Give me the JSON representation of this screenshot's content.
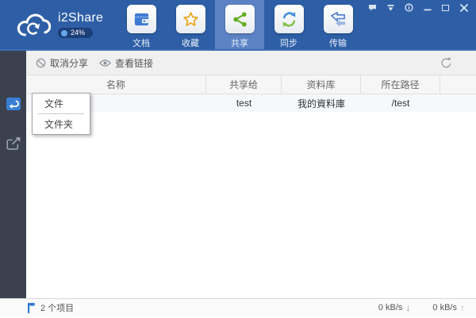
{
  "app": {
    "title": "i2Share",
    "progress_label": "24%"
  },
  "header": {
    "tabs": [
      {
        "label": "文档",
        "icon": "documents-icon"
      },
      {
        "label": "收藏",
        "icon": "favorites-star-icon"
      },
      {
        "label": "共享",
        "icon": "share-icon",
        "active": true
      },
      {
        "label": "同步",
        "icon": "sync-icon"
      },
      {
        "label": "传输",
        "icon": "transfer-icon"
      }
    ],
    "window_controls": [
      "feedback-icon",
      "menu-icon",
      "info-icon",
      "minimize-icon",
      "maximize-icon",
      "close-icon"
    ]
  },
  "toolbar": {
    "cancel_share": "取消分享",
    "view_links": "查看链接"
  },
  "table": {
    "columns": [
      "名称",
      "共享给",
      "资料库",
      "所在路径"
    ],
    "rows": [
      {
        "name": "",
        "shared_to": "test",
        "library": "我的資料庫",
        "path": "/test"
      }
    ]
  },
  "context_menu": {
    "items": [
      {
        "label": "文件"
      },
      {
        "label": "文件夹"
      }
    ]
  },
  "status_bar": {
    "item_count": "2 个项目",
    "download_speed": "0 kB/s",
    "download_arrow": "↓",
    "upload_speed": "0 kB/s",
    "upload_arrow": "↑"
  },
  "colors": {
    "header_blue": "#2e5fa6",
    "active_tab_blue": "#5b83c4",
    "sidebar_dark": "#3b414e",
    "accent_blue": "#3a7fd5",
    "share_green": "#63ad21",
    "star_orange": "#eba21a"
  }
}
